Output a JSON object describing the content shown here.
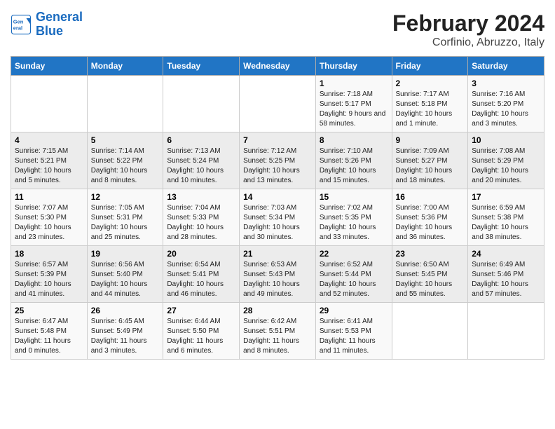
{
  "header": {
    "logo_line1": "General",
    "logo_line2": "Blue",
    "title": "February 2024",
    "subtitle": "Corfinio, Abruzzo, Italy"
  },
  "weekdays": [
    "Sunday",
    "Monday",
    "Tuesday",
    "Wednesday",
    "Thursday",
    "Friday",
    "Saturday"
  ],
  "weeks": [
    [
      {
        "day": "",
        "info": ""
      },
      {
        "day": "",
        "info": ""
      },
      {
        "day": "",
        "info": ""
      },
      {
        "day": "",
        "info": ""
      },
      {
        "day": "1",
        "info": "Sunrise: 7:18 AM\nSunset: 5:17 PM\nDaylight: 9 hours and 58 minutes."
      },
      {
        "day": "2",
        "info": "Sunrise: 7:17 AM\nSunset: 5:18 PM\nDaylight: 10 hours and 1 minute."
      },
      {
        "day": "3",
        "info": "Sunrise: 7:16 AM\nSunset: 5:20 PM\nDaylight: 10 hours and 3 minutes."
      }
    ],
    [
      {
        "day": "4",
        "info": "Sunrise: 7:15 AM\nSunset: 5:21 PM\nDaylight: 10 hours and 5 minutes."
      },
      {
        "day": "5",
        "info": "Sunrise: 7:14 AM\nSunset: 5:22 PM\nDaylight: 10 hours and 8 minutes."
      },
      {
        "day": "6",
        "info": "Sunrise: 7:13 AM\nSunset: 5:24 PM\nDaylight: 10 hours and 10 minutes."
      },
      {
        "day": "7",
        "info": "Sunrise: 7:12 AM\nSunset: 5:25 PM\nDaylight: 10 hours and 13 minutes."
      },
      {
        "day": "8",
        "info": "Sunrise: 7:10 AM\nSunset: 5:26 PM\nDaylight: 10 hours and 15 minutes."
      },
      {
        "day": "9",
        "info": "Sunrise: 7:09 AM\nSunset: 5:27 PM\nDaylight: 10 hours and 18 minutes."
      },
      {
        "day": "10",
        "info": "Sunrise: 7:08 AM\nSunset: 5:29 PM\nDaylight: 10 hours and 20 minutes."
      }
    ],
    [
      {
        "day": "11",
        "info": "Sunrise: 7:07 AM\nSunset: 5:30 PM\nDaylight: 10 hours and 23 minutes."
      },
      {
        "day": "12",
        "info": "Sunrise: 7:05 AM\nSunset: 5:31 PM\nDaylight: 10 hours and 25 minutes."
      },
      {
        "day": "13",
        "info": "Sunrise: 7:04 AM\nSunset: 5:33 PM\nDaylight: 10 hours and 28 minutes."
      },
      {
        "day": "14",
        "info": "Sunrise: 7:03 AM\nSunset: 5:34 PM\nDaylight: 10 hours and 30 minutes."
      },
      {
        "day": "15",
        "info": "Sunrise: 7:02 AM\nSunset: 5:35 PM\nDaylight: 10 hours and 33 minutes."
      },
      {
        "day": "16",
        "info": "Sunrise: 7:00 AM\nSunset: 5:36 PM\nDaylight: 10 hours and 36 minutes."
      },
      {
        "day": "17",
        "info": "Sunrise: 6:59 AM\nSunset: 5:38 PM\nDaylight: 10 hours and 38 minutes."
      }
    ],
    [
      {
        "day": "18",
        "info": "Sunrise: 6:57 AM\nSunset: 5:39 PM\nDaylight: 10 hours and 41 minutes."
      },
      {
        "day": "19",
        "info": "Sunrise: 6:56 AM\nSunset: 5:40 PM\nDaylight: 10 hours and 44 minutes."
      },
      {
        "day": "20",
        "info": "Sunrise: 6:54 AM\nSunset: 5:41 PM\nDaylight: 10 hours and 46 minutes."
      },
      {
        "day": "21",
        "info": "Sunrise: 6:53 AM\nSunset: 5:43 PM\nDaylight: 10 hours and 49 minutes."
      },
      {
        "day": "22",
        "info": "Sunrise: 6:52 AM\nSunset: 5:44 PM\nDaylight: 10 hours and 52 minutes."
      },
      {
        "day": "23",
        "info": "Sunrise: 6:50 AM\nSunset: 5:45 PM\nDaylight: 10 hours and 55 minutes."
      },
      {
        "day": "24",
        "info": "Sunrise: 6:49 AM\nSunset: 5:46 PM\nDaylight: 10 hours and 57 minutes."
      }
    ],
    [
      {
        "day": "25",
        "info": "Sunrise: 6:47 AM\nSunset: 5:48 PM\nDaylight: 11 hours and 0 minutes."
      },
      {
        "day": "26",
        "info": "Sunrise: 6:45 AM\nSunset: 5:49 PM\nDaylight: 11 hours and 3 minutes."
      },
      {
        "day": "27",
        "info": "Sunrise: 6:44 AM\nSunset: 5:50 PM\nDaylight: 11 hours and 6 minutes."
      },
      {
        "day": "28",
        "info": "Sunrise: 6:42 AM\nSunset: 5:51 PM\nDaylight: 11 hours and 8 minutes."
      },
      {
        "day": "29",
        "info": "Sunrise: 6:41 AM\nSunset: 5:53 PM\nDaylight: 11 hours and 11 minutes."
      },
      {
        "day": "",
        "info": ""
      },
      {
        "day": "",
        "info": ""
      }
    ]
  ]
}
